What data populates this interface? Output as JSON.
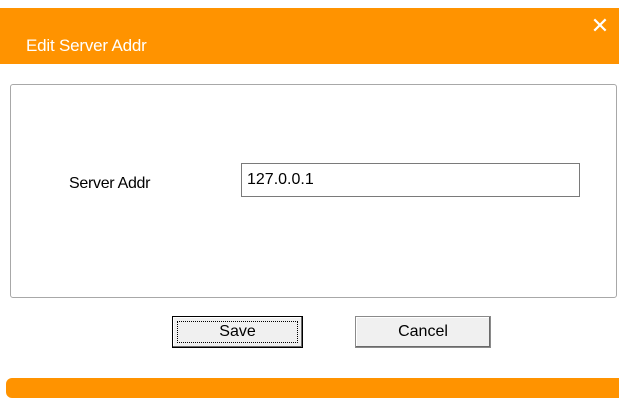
{
  "dialog": {
    "title": "Edit Server Addr",
    "close_symbol": "✕",
    "close_icon": "close-icon",
    "accent_color": "#ff9300"
  },
  "form": {
    "server_addr_label": "Server Addr",
    "server_addr_value": "127.0.0.1"
  },
  "buttons": {
    "save_label": "Save",
    "cancel_label": "Cancel"
  }
}
